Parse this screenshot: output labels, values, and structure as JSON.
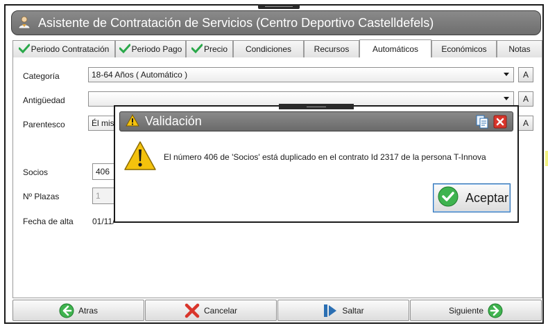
{
  "window": {
    "title": "Asistente de Contratación de Servicios (Centro Deportivo Castelldefels)"
  },
  "tabs": [
    {
      "label": "Periodo Contratación",
      "checked": true
    },
    {
      "label": "Periodo Pago",
      "checked": true
    },
    {
      "label": "Precio",
      "checked": true
    },
    {
      "label": "Condiciones",
      "checked": false
    },
    {
      "label": "Recursos",
      "checked": false
    },
    {
      "label": "Automáticos",
      "checked": false,
      "active": true
    },
    {
      "label": "Económicos",
      "checked": false
    },
    {
      "label": "Notas",
      "checked": false
    }
  ],
  "form": {
    "categoria": {
      "label": "Categoría",
      "value": "18-64 Años ( Automático )",
      "button": "A"
    },
    "antiguedad": {
      "label": "Antigüedad",
      "value": "",
      "button": "A"
    },
    "parentesco": {
      "label": "Parentesco",
      "value": "Él mism",
      "button": "A"
    },
    "socios": {
      "label": "Socios",
      "value": "406"
    },
    "plazas": {
      "label": "Nº Plazas",
      "value": "1"
    },
    "fecha_alta": {
      "label": "Fecha de alta",
      "value": "01/11/"
    }
  },
  "nav": {
    "atras": "Atras",
    "cancelar": "Cancelar",
    "saltar": "Saltar",
    "siguiente": "Siguiente"
  },
  "dialog": {
    "title": "Validación",
    "message": "El número 406 de 'Socios' está duplicado en el contrato Id 2317 de la persona T-Innova",
    "ok_label": "Aceptar",
    "icons": [
      "copy-icon",
      "close-icon",
      "warning-icon"
    ]
  },
  "colors": {
    "titlebar": "#7c7c7c",
    "check_green": "#2aa84a",
    "warning_yellow": "#f4c20d",
    "close_red": "#d9352b",
    "ok_border": "#2b6fb3"
  }
}
